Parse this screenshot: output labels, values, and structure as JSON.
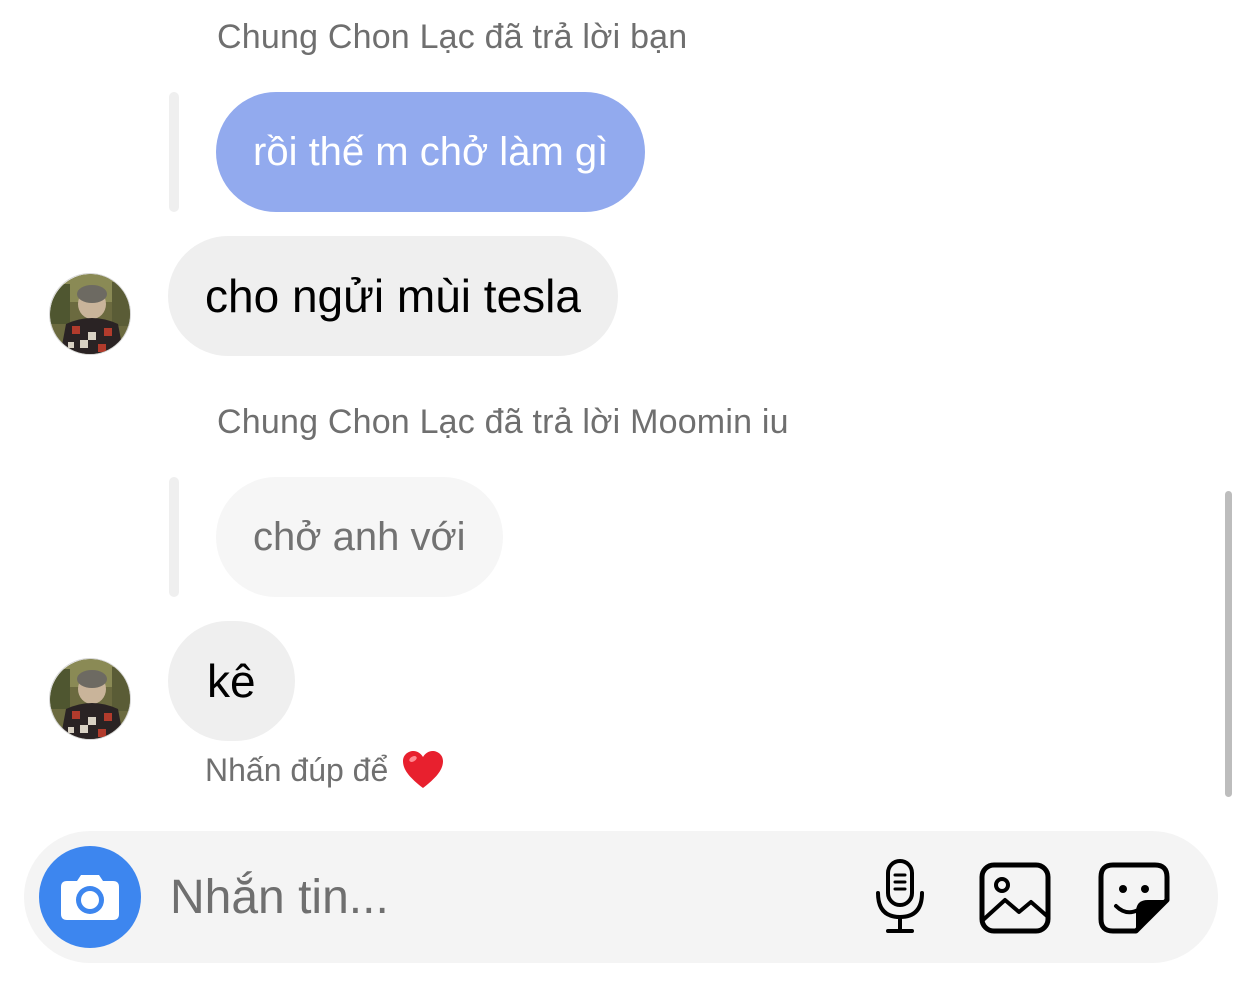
{
  "thread": [
    {
      "reply_caption": "Chung Chon Lạc đã trả lời bạn",
      "quoted_text": "rồi thế m chở làm gì",
      "message": "cho ngửi mùi tesla"
    },
    {
      "reply_caption": "Chung Chon Lạc đã trả lời Moomin iu",
      "quoted_text": "chở anh với",
      "message": "kê"
    }
  ],
  "like_hint": {
    "text": "Nhấn đúp để",
    "emoji": "❤️"
  },
  "composer": {
    "placeholder": "Nhắn tin...",
    "icons": [
      "camera-icon",
      "microphone-icon",
      "gallery-icon",
      "sticker-icon"
    ],
    "accent_color": "#3d86ef"
  },
  "colors": {
    "own_quoted_bubble": "#92aaee",
    "other_bubble": "#efefef",
    "quoted_other_bubble": "#f6f6f6"
  }
}
